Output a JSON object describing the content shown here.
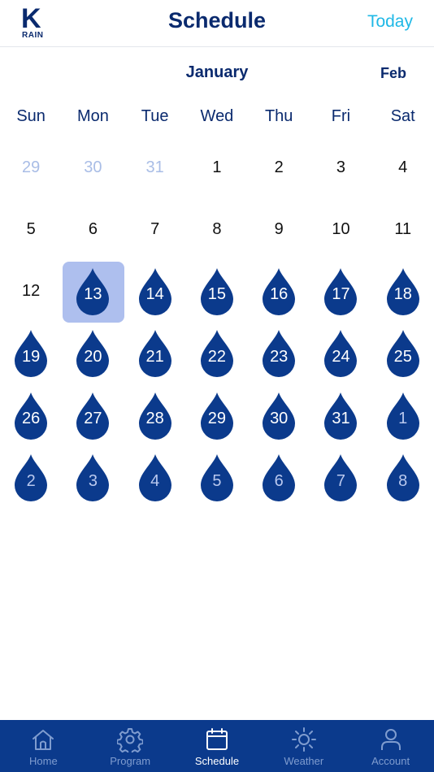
{
  "header": {
    "logo_k": "K",
    "logo_rain": "RAIN",
    "title": "Schedule",
    "today_label": "Today"
  },
  "month": {
    "current": "January",
    "next": "Feb"
  },
  "weekdays": [
    "Sun",
    "Mon",
    "Tue",
    "Wed",
    "Thu",
    "Fri",
    "Sat"
  ],
  "days": [
    {
      "label": "29",
      "muted": true,
      "water": false,
      "selected": false
    },
    {
      "label": "30",
      "muted": true,
      "water": false,
      "selected": false
    },
    {
      "label": "31",
      "muted": true,
      "water": false,
      "selected": false
    },
    {
      "label": "1",
      "muted": false,
      "water": false,
      "selected": false
    },
    {
      "label": "2",
      "muted": false,
      "water": false,
      "selected": false
    },
    {
      "label": "3",
      "muted": false,
      "water": false,
      "selected": false
    },
    {
      "label": "4",
      "muted": false,
      "water": false,
      "selected": false
    },
    {
      "label": "5",
      "muted": false,
      "water": false,
      "selected": false
    },
    {
      "label": "6",
      "muted": false,
      "water": false,
      "selected": false
    },
    {
      "label": "7",
      "muted": false,
      "water": false,
      "selected": false
    },
    {
      "label": "8",
      "muted": false,
      "water": false,
      "selected": false
    },
    {
      "label": "9",
      "muted": false,
      "water": false,
      "selected": false
    },
    {
      "label": "10",
      "muted": false,
      "water": false,
      "selected": false
    },
    {
      "label": "11",
      "muted": false,
      "water": false,
      "selected": false
    },
    {
      "label": "12",
      "muted": false,
      "water": false,
      "selected": false
    },
    {
      "label": "13",
      "muted": false,
      "water": true,
      "selected": true
    },
    {
      "label": "14",
      "muted": false,
      "water": true,
      "selected": false
    },
    {
      "label": "15",
      "muted": false,
      "water": true,
      "selected": false
    },
    {
      "label": "16",
      "muted": false,
      "water": true,
      "selected": false
    },
    {
      "label": "17",
      "muted": false,
      "water": true,
      "selected": false
    },
    {
      "label": "18",
      "muted": false,
      "water": true,
      "selected": false
    },
    {
      "label": "19",
      "muted": false,
      "water": true,
      "selected": false
    },
    {
      "label": "20",
      "muted": false,
      "water": true,
      "selected": false
    },
    {
      "label": "21",
      "muted": false,
      "water": true,
      "selected": false
    },
    {
      "label": "22",
      "muted": false,
      "water": true,
      "selected": false
    },
    {
      "label": "23",
      "muted": false,
      "water": true,
      "selected": false
    },
    {
      "label": "24",
      "muted": false,
      "water": true,
      "selected": false
    },
    {
      "label": "25",
      "muted": false,
      "water": true,
      "selected": false
    },
    {
      "label": "26",
      "muted": false,
      "water": true,
      "selected": false
    },
    {
      "label": "27",
      "muted": false,
      "water": true,
      "selected": false
    },
    {
      "label": "28",
      "muted": false,
      "water": true,
      "selected": false
    },
    {
      "label": "29",
      "muted": false,
      "water": true,
      "selected": false
    },
    {
      "label": "30",
      "muted": false,
      "water": true,
      "selected": false
    },
    {
      "label": "31",
      "muted": false,
      "water": true,
      "selected": false
    },
    {
      "label": "1",
      "muted": true,
      "water": true,
      "selected": false
    },
    {
      "label": "2",
      "muted": true,
      "water": true,
      "selected": false
    },
    {
      "label": "3",
      "muted": true,
      "water": true,
      "selected": false
    },
    {
      "label": "4",
      "muted": true,
      "water": true,
      "selected": false
    },
    {
      "label": "5",
      "muted": true,
      "water": true,
      "selected": false
    },
    {
      "label": "6",
      "muted": true,
      "water": true,
      "selected": false
    },
    {
      "label": "7",
      "muted": true,
      "water": true,
      "selected": false
    },
    {
      "label": "8",
      "muted": true,
      "water": true,
      "selected": false
    }
  ],
  "tabs": [
    {
      "label": "Home",
      "icon": "home-icon",
      "active": false
    },
    {
      "label": "Program",
      "icon": "gear-icon",
      "active": false
    },
    {
      "label": "Schedule",
      "icon": "calendar-icon",
      "active": true
    },
    {
      "label": "Weather",
      "icon": "sun-icon",
      "active": false
    },
    {
      "label": "Account",
      "icon": "person-icon",
      "active": false
    }
  ],
  "colors": {
    "brand_navy": "#0b3a8c",
    "drop_fill": "#0b3a8c",
    "accent_cyan": "#1fb8e6",
    "selected_bg": "#aebfee",
    "muted_text": "#a9bde6"
  }
}
